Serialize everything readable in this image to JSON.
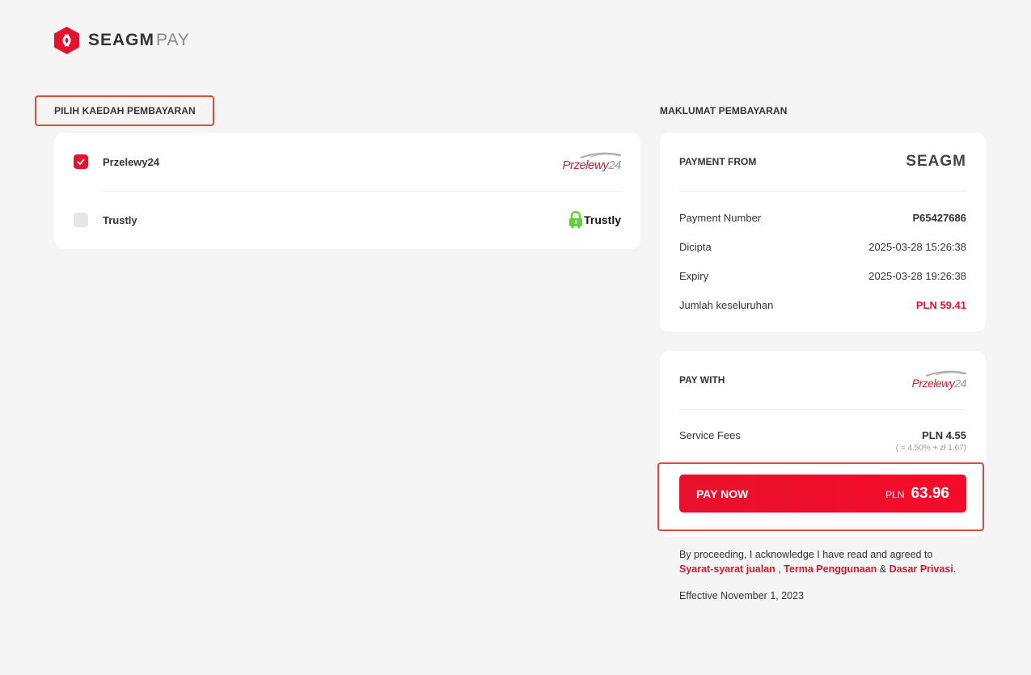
{
  "brand": {
    "name": "SEAGM",
    "suffix": "PAY"
  },
  "left": {
    "title": "PILIH KAEDAH PEMBAYARAN",
    "methods": [
      {
        "name": "Przelewy24",
        "checked": true,
        "logo_main": "Przelewy",
        "logo_num": "24",
        "icon": "przelewy24-logo"
      },
      {
        "name": "Trustly",
        "checked": false,
        "logo_text": "Trustly",
        "icon": "trustly-logo"
      }
    ]
  },
  "right": {
    "title": "MAKLUMAT PEMBAYARAN",
    "info": {
      "head_label": "PAYMENT FROM",
      "head_logo": "SEAGM",
      "rows": [
        {
          "label": "Payment Number",
          "value": "P65427686"
        },
        {
          "label": "Dicipta",
          "value": "2025-03-28 15:26:38"
        },
        {
          "label": "Expiry",
          "value": "2025-03-28 19:26:38"
        },
        {
          "label": "Jumlah keseluruhan",
          "value": "PLN 59.41"
        }
      ]
    },
    "paywith": {
      "head_label": "PAY WITH",
      "logo_main": "Przelewy",
      "logo_num": "24",
      "fee_label": "Service Fees",
      "fee_value": "PLN 4.55",
      "fee_note": "( = 4.50% + zł 1.67)"
    },
    "pay_button": {
      "label": "PAY NOW",
      "currency": "PLN",
      "amount": "63.96"
    },
    "terms": {
      "prefix": "By proceeding, I acknowledge I have read and agreed to",
      "link1": "Syarat-syarat jualan",
      "sep1": " , ",
      "link2": "Terma Penggunaan",
      "sep2": " & ",
      "link3": "Dasar Privasi",
      "end": ".",
      "effective": "Effective November 1, 2023"
    }
  },
  "colors": {
    "accent": "#e8112d",
    "highlight": "#e14a33",
    "background": "#f5f5f5"
  }
}
